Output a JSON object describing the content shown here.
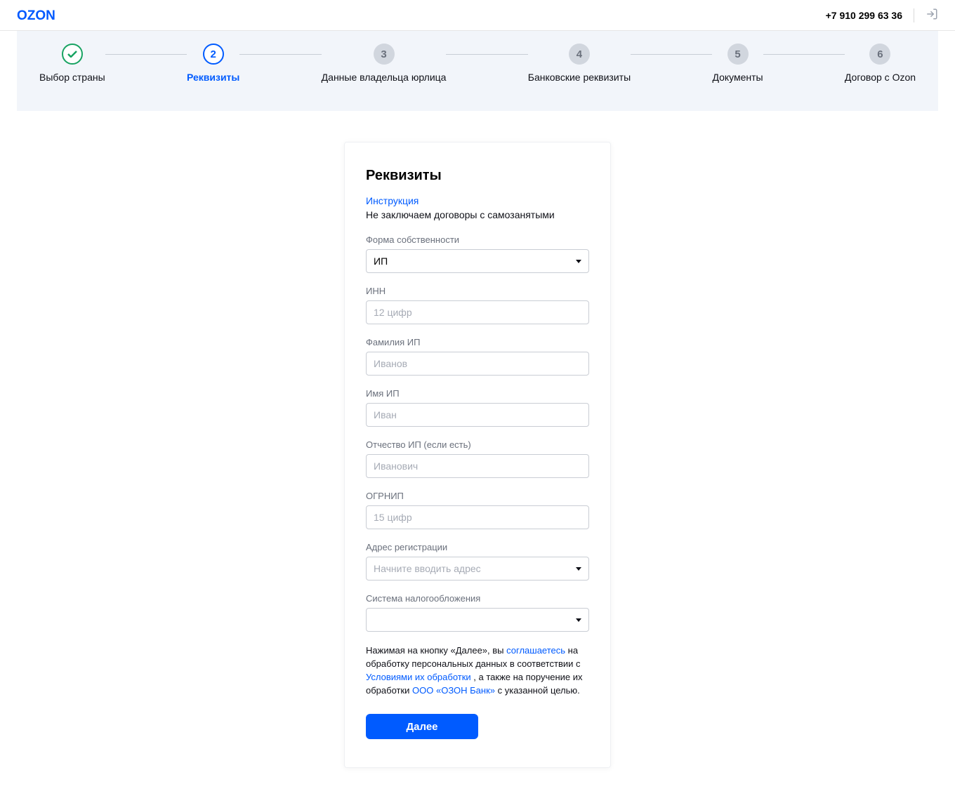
{
  "header": {
    "logo_text": "OZON",
    "phone": "+7 910 299 63 36"
  },
  "steps": [
    {
      "num": "1",
      "label": "Выбор страны",
      "state": "done"
    },
    {
      "num": "2",
      "label": "Реквизиты",
      "state": "active"
    },
    {
      "num": "3",
      "label": "Данные владельца юрлица",
      "state": "pending"
    },
    {
      "num": "4",
      "label": "Банковские реквизиты",
      "state": "pending"
    },
    {
      "num": "5",
      "label": "Документы",
      "state": "pending"
    },
    {
      "num": "6",
      "label": "Договор с Ozon",
      "state": "pending"
    }
  ],
  "form": {
    "title": "Реквизиты",
    "instruction_link": "Инструкция",
    "warning": "Не заключаем договоры с самозанятыми",
    "fields": {
      "ownership": {
        "label": "Форма собственности",
        "value": "ИП"
      },
      "inn": {
        "label": "ИНН",
        "placeholder": "12 цифр",
        "value": ""
      },
      "lastname": {
        "label": "Фамилия ИП",
        "placeholder": "Иванов",
        "value": ""
      },
      "firstname": {
        "label": "Имя ИП",
        "placeholder": "Иван",
        "value": ""
      },
      "patronymic": {
        "label": "Отчество ИП (если есть)",
        "placeholder": "Иванович",
        "value": ""
      },
      "ogrnip": {
        "label": "ОГРНИП",
        "placeholder": "15 цифр",
        "value": ""
      },
      "address": {
        "label": "Адрес регистрации",
        "placeholder": "Начните вводить адрес",
        "value": ""
      },
      "tax": {
        "label": "Система налогообложения",
        "value": ""
      }
    },
    "consent": {
      "p1": "Нажимая на кнопку «Далее», вы ",
      "l1": "соглашаетесь",
      "p2": " на обработку персональных данных в соответствии с ",
      "l2": "Условиями их обработки",
      "p3": " , а также на поручение их обработки ",
      "l3": "ООО «ОЗОН Банк»",
      "p4": " с указанной целью."
    },
    "next_button": "Далее"
  }
}
